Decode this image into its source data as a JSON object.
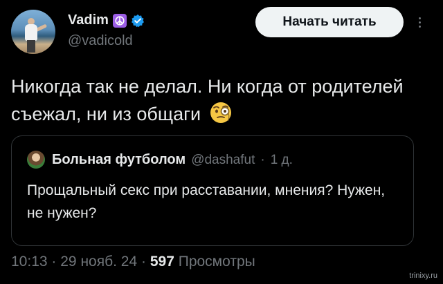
{
  "author": {
    "name": "Vadim",
    "handle": "@vadicold",
    "badge_icon": "peace-sign-icon",
    "verified_icon": "verified-badge-icon",
    "verified_color": "#1d9bf0"
  },
  "header": {
    "follow_label": "Начать читать",
    "more_icon": "more-options-icon"
  },
  "tweet": {
    "text": "Никогда так не делал. Ни когда от родителей съежал, ни из общаги",
    "emoji": "face-with-monocle"
  },
  "quote": {
    "name": "Больная футболом",
    "handle": "@dashafut",
    "separator": "·",
    "time": "1 д.",
    "text": "Прощальный секс при расставании, мнения? Нужен, не нужен?"
  },
  "meta": {
    "time": "10:13",
    "sep1": "·",
    "date": "29 нояб. 24",
    "sep2": "·",
    "views_count": "597",
    "views_label": "Просмотры"
  },
  "watermark": "trinixy.ru",
  "colors": {
    "background": "#000000",
    "text": "#e7e9ea",
    "muted": "#71767b",
    "button_bg": "#eff3f4",
    "border": "#2f3336"
  }
}
